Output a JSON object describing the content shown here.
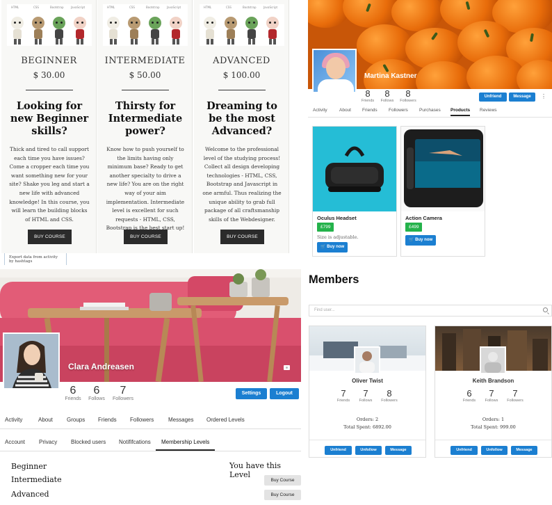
{
  "pricing": {
    "icon_labels": [
      "HTML",
      "CSS",
      "Bootstrap",
      "JavaScript"
    ],
    "plans": [
      {
        "tier": "BEGINNER",
        "price": "$ 30.00",
        "headline": "Looking for new Beginner skills?",
        "description": "Thick and tired to call support each time you have issues? Come a cropper each time you want something new for your site? Shake you leg and start a new life with advanced knowledge! In this course, you will learn the building blocks of HTML and CSS.",
        "button": "BUY COURSE"
      },
      {
        "tier": "INTERMEDIATE",
        "price": "$ 50.00",
        "headline": "Thirsty for Intermediate power?",
        "description": "Know how to push yourself to the limits having only minimum base? Ready to get another specialty to drive a new life? You are on the right way of your aim implementation. Intermediate level is excellent for such requests - HTML, CSS, Bootstrap is the best start up!",
        "button": "BUY COURSE"
      },
      {
        "tier": "ADVANCED",
        "price": "$ 100.00",
        "headline": "Dreaming to be the most Advanced?",
        "description": "Welcome to the professional level of the studying process! Collect all design developing technologies - HTML, CSS, Bootstrap and Javascript in one armful. Thus realizing the unique ability to grab full package of all craftsmanship skills of the Webdesigner.",
        "button": "BUY COURSE"
      }
    ],
    "export_note": "Export data from activity by hashtags"
  },
  "martina": {
    "name": "Martina Kastner",
    "stats": [
      {
        "num": "8",
        "label": "Friends"
      },
      {
        "num": "8",
        "label": "Follows"
      },
      {
        "num": "8",
        "label": "Followers"
      }
    ],
    "unfriend": "Unfriend",
    "message": "Message",
    "more": "⋮",
    "tabs": [
      "Activity",
      "About",
      "Friends",
      "Followers",
      "Purchases",
      "Products",
      "Reviews"
    ],
    "active_tab": "Products",
    "products": [
      {
        "name": "Oculus Headset",
        "price": "£799",
        "note": "Size is adjustable.",
        "buy": "Buy now"
      },
      {
        "name": "Action Camera",
        "price": "£499",
        "note": "",
        "buy": "Buy now"
      }
    ]
  },
  "members": {
    "title": "Members",
    "search_placeholder": "Find user...",
    "cards": [
      {
        "name": "Oliver Twist",
        "stats": [
          {
            "num": "7",
            "label": "Friends"
          },
          {
            "num": "7",
            "label": "Follows"
          },
          {
            "num": "8",
            "label": "Followers"
          }
        ],
        "orders": "Orders: 2",
        "spent": "Total Spent: 6892.00",
        "buttons": [
          "Unfriend",
          "Unfollow",
          "Message"
        ]
      },
      {
        "name": "Keith Brandson",
        "stats": [
          {
            "num": "6",
            "label": "Friends"
          },
          {
            "num": "7",
            "label": "Follows"
          },
          {
            "num": "7",
            "label": "Followers"
          }
        ],
        "orders": "Orders: 1",
        "spent": "Total Spent: 999.00",
        "buttons": [
          "Unfriend",
          "Unfollow",
          "Message"
        ]
      }
    ]
  },
  "clara": {
    "name": "Clara Andreasen",
    "stats": [
      {
        "num": "6",
        "label": "Friends"
      },
      {
        "num": "6",
        "label": "Follows"
      },
      {
        "num": "7",
        "label": "Followers"
      }
    ],
    "settings": "Settings",
    "logout": "Logout",
    "tabs_primary": [
      "Activity",
      "About",
      "Groups",
      "Friends",
      "Followers",
      "Messages",
      "Ordered Levels"
    ],
    "tabs_secondary": [
      "Account",
      "Privacy",
      "Blocked users",
      "Notififcations",
      "Membership Levels"
    ],
    "active_tab": "Membership Levels",
    "levels": [
      "Beginner",
      "Intermediate",
      "Advanced"
    ],
    "current_level_note": "You have this Level",
    "buy_course": "Buy Course"
  },
  "colors": {
    "accent_blue": "#1b7fd1",
    "price_green": "#24b24b",
    "dark_button": "#2b2b2b"
  }
}
